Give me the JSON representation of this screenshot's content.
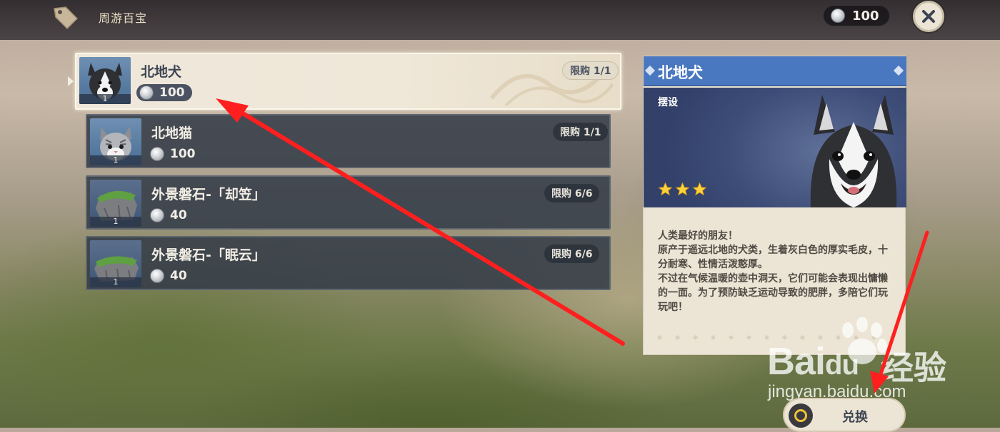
{
  "header": {
    "title": "周游百宝",
    "icon": "price-tag-icon",
    "currency": {
      "icon": "silver-coin-icon",
      "amount": "100"
    },
    "close_icon": "close-icon"
  },
  "items": [
    {
      "name": "北地犬",
      "price": "100",
      "limit": "限购 1/1",
      "qty": "1",
      "selected": true
    },
    {
      "name": "北地猫",
      "price": "100",
      "limit": "限购 1/1",
      "qty": "1",
      "selected": false
    },
    {
      "name": "外景磐石-「却笠」",
      "price": "40",
      "limit": "限购 6/6",
      "qty": "1",
      "selected": false
    },
    {
      "name": "外景磐石-「眠云」",
      "price": "40",
      "limit": "限购 6/6",
      "qty": "1",
      "selected": false
    }
  ],
  "detail": {
    "title": "北地犬",
    "category": "摆设",
    "rating": 3,
    "description": [
      "人类最好的朋友！",
      "原产于遥远北地的犬类，生着灰白色的厚实毛皮，十分耐寒、性情活泼憨厚。",
      "不过在气候温暖的壶中洞天，它们可能会表现出慵懒的一面。为了预防缺乏运动导致的肥胖，多陪它们玩玩吧！"
    ],
    "header_color": "#4a78c0"
  },
  "exchange_button": {
    "label": "兑换"
  },
  "watermark": {
    "brand": "Bai",
    "brand2": "du",
    "cn": "经验",
    "url": "jingyan.baidu.com"
  },
  "annotation_color": "#ff1f1f"
}
